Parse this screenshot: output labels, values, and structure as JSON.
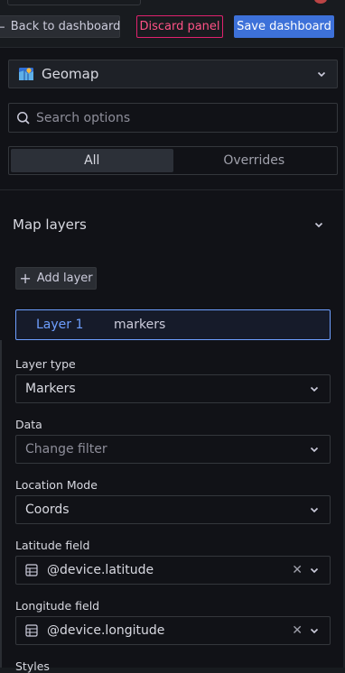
{
  "toolbar": {
    "back_label": "Back to dashboard",
    "discard_label": "Discard panel",
    "save_label": "Save dashboard"
  },
  "viz_picker": {
    "label": "Geomap",
    "icon": "map-icon"
  },
  "search": {
    "placeholder": "Search options"
  },
  "tabs": {
    "all": "All",
    "overrides": "Overrides",
    "active": "All"
  },
  "section": {
    "title": "Map layers"
  },
  "add_layer": {
    "label": "Add layer"
  },
  "layer": {
    "name": "Layer 1",
    "type": "markers"
  },
  "fields": {
    "layer_type": {
      "label": "Layer type",
      "value": "Markers"
    },
    "data": {
      "label": "Data",
      "placeholder": "Change filter"
    },
    "location_mode": {
      "label": "Location Mode",
      "value": "Coords"
    },
    "latitude": {
      "label": "Latitude field",
      "value": "@device.latitude"
    },
    "longitude": {
      "label": "Longitude field",
      "value": "@device.longitude"
    },
    "styles": {
      "label": "Styles"
    }
  },
  "colors": {
    "accent": "#3d71d9",
    "destructive": "#ff5286",
    "selected_layer": "#6e9fff"
  }
}
